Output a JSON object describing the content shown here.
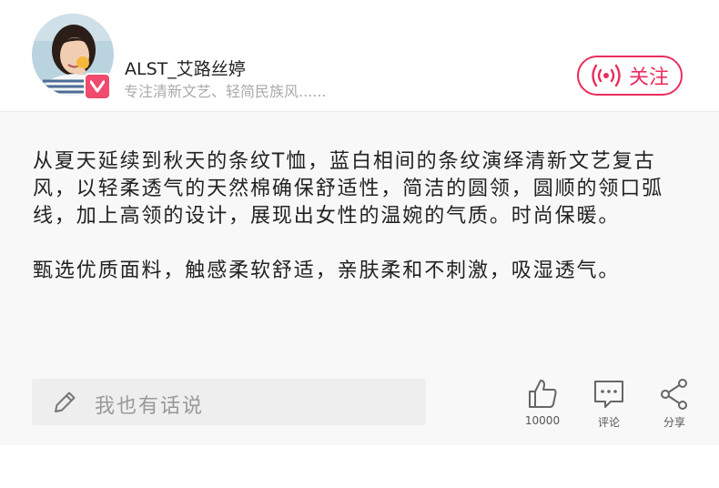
{
  "author": {
    "name": "ALST_艾路丝婷",
    "bio": "专注清新文艺、轻简民族风......",
    "avatar_icon": "woman-portrait-avatar",
    "badge_icon": "v-verified-icon"
  },
  "follow_button": {
    "label": "关注",
    "icon": "broadcast-icon",
    "color": "#ea2e5e"
  },
  "article": {
    "paragraphs": [
      "从夏天延续到秋天的条纹T恤，蓝白相间的条纹演绎清新文艺复古风，以轻柔透气的天然棉确保舒适性，简洁的圆领，圆顺的领口弧线，加上高领的设计，展现出女性的温婉的气质。时尚保暖。",
      "甄选优质面料，触感柔软舒适，亲肤柔和不刺激，吸湿透气。"
    ]
  },
  "comment": {
    "placeholder": "我也有话说",
    "icon": "pencil-icon"
  },
  "actions": [
    {
      "label": "10000",
      "icon": "thumbs-up-icon"
    },
    {
      "label": "评论",
      "icon": "comment-icon"
    },
    {
      "label": "分享",
      "icon": "share-icon"
    }
  ]
}
